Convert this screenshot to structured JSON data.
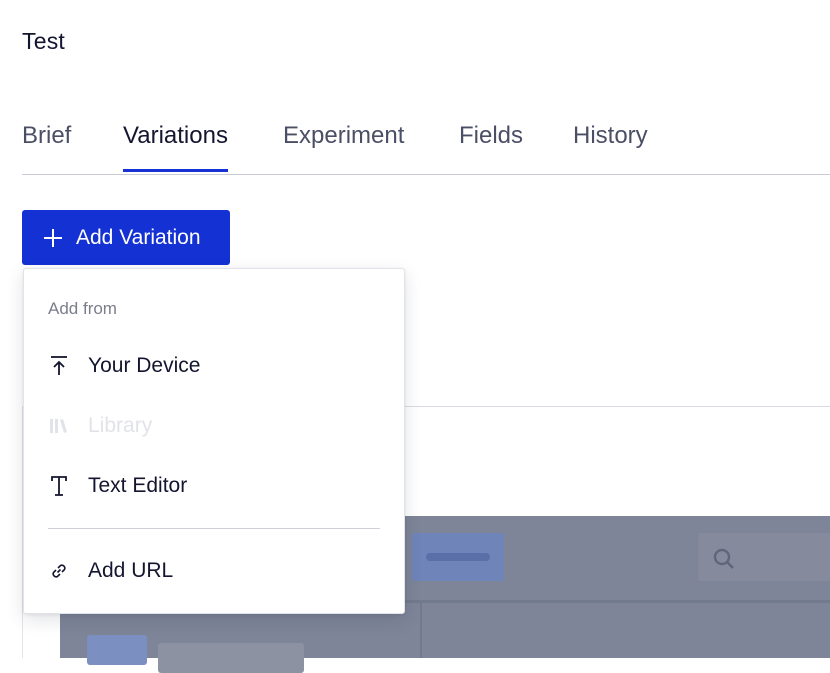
{
  "page": {
    "title": "Test"
  },
  "tabs": [
    {
      "label": "Brief",
      "active": false
    },
    {
      "label": "Variations",
      "active": true
    },
    {
      "label": "Experiment",
      "active": false
    },
    {
      "label": "Fields",
      "active": false
    },
    {
      "label": "History",
      "active": false
    }
  ],
  "add_variation": {
    "label": "Add Variation",
    "icon": "plus-icon"
  },
  "dropdown": {
    "heading": "Add from",
    "items": [
      {
        "label": "Your Device",
        "icon": "upload-icon",
        "enabled": true
      },
      {
        "label": "Library",
        "icon": "library-icon",
        "enabled": false
      },
      {
        "label": "Text Editor",
        "icon": "text-icon",
        "enabled": true
      },
      {
        "label": "Add URL",
        "icon": "link-icon",
        "enabled": true
      }
    ]
  },
  "colors": {
    "accent": "#1431d4",
    "text": "#14152f",
    "muted": "#7a7d8c",
    "disabled": "#e1e3e8",
    "preview_overlay": "#7e8598"
  }
}
